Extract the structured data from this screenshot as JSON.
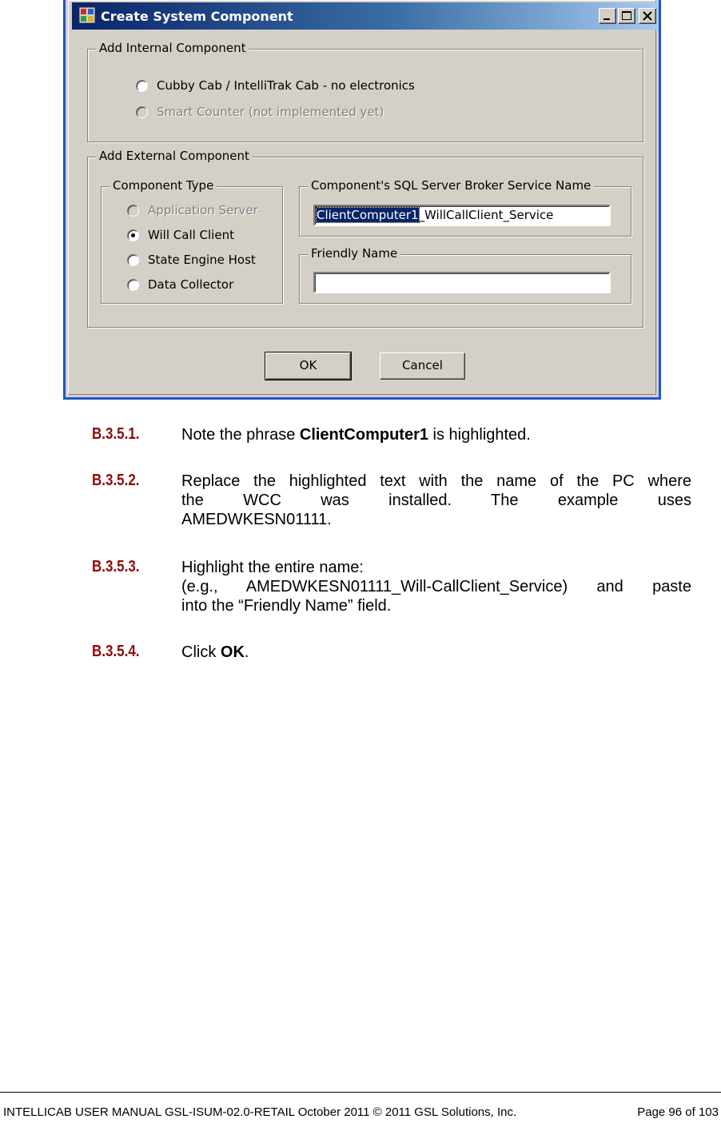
{
  "dialog": {
    "title": "Create System Component",
    "internal_group": {
      "legend": "Add Internal Component",
      "options": [
        {
          "label": "Cubby Cab / IntelliTrak Cab - no electronics",
          "selected": false,
          "enabled": true
        },
        {
          "label": "Smart Counter (not implemented yet)",
          "selected": false,
          "enabled": false
        }
      ]
    },
    "external_group": {
      "legend": "Add External Component",
      "component_type": {
        "legend": "Component Type",
        "options": [
          {
            "label": "Application Server",
            "selected": false,
            "enabled": false
          },
          {
            "label": "Will Call Client",
            "selected": true,
            "enabled": true
          },
          {
            "label": "State Engine Host",
            "selected": false,
            "enabled": true
          },
          {
            "label": "Data Collector",
            "selected": false,
            "enabled": true
          }
        ]
      },
      "broker": {
        "legend": "Component's SQL Server Broker Service Name",
        "value_selected": "ClientComputer1",
        "value_rest": "_WillCallClient_Service"
      },
      "friendly": {
        "legend": "Friendly Name",
        "value": ""
      }
    },
    "buttons": {
      "ok": "OK",
      "cancel": "Cancel"
    }
  },
  "steps": [
    {
      "num": "B.3.5.1.",
      "pre": "Note the phrase ",
      "bold": "ClientComputer1",
      "post": " is highlighted."
    },
    {
      "num": "B.3.5.2.",
      "line1": "Replace the highlighted text with the name of the PC where",
      "line2": "the WCC was installed. The example uses",
      "line3": "AMEDWKESN01111."
    },
    {
      "num": "B.3.5.3.",
      "line1": "Highlight the entire name:",
      "line2": "(e.g., AMEDWKESN01111_Will-CallClient_Service) and paste",
      "line3": "into the “Friendly Name” field."
    },
    {
      "num": "B.3.5.4.",
      "pre": "Click ",
      "bold": "OK",
      "post": "."
    }
  ],
  "footer": {
    "left": "INTELLICAB USER MANUAL GSL-ISUM-02.0-RETAIL October 2011 © 2011 GSL Solutions, Inc.",
    "right": "Page 96 of 103"
  },
  "colors": {
    "step_number": "#8a0b0b",
    "titlebar": "#0a246a",
    "dialog_border": "#1d56c8"
  }
}
